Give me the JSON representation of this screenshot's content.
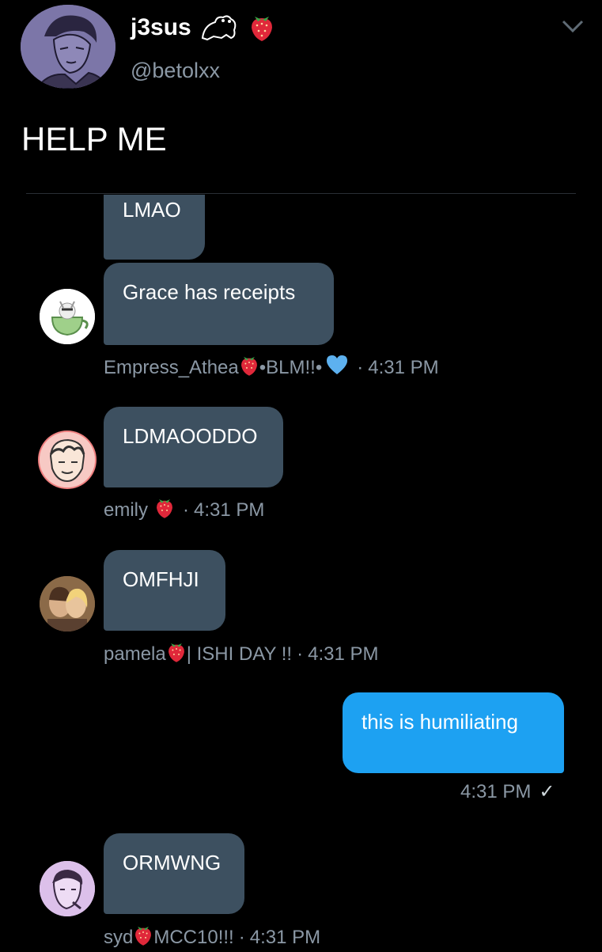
{
  "tweet": {
    "display_name": "j3sus",
    "handle": "@betolxx",
    "text": "HELP ME",
    "name_icons": [
      "frog-icon",
      "strawberry-icon"
    ]
  },
  "messages": [
    {
      "text": "LMAO"
    },
    {
      "text": "Grace has receipts",
      "sender": "Empress_Athea",
      "sender_suffix": "•BLM!!•",
      "time": "4:31 PM"
    },
    {
      "text": "LDMAOODDO",
      "sender": "emily",
      "time": "4:31 PM"
    },
    {
      "text": "OMFHJI",
      "sender": "pamela",
      "sender_suffix": "| ISHI DAY !!",
      "time": "4:31 PM"
    },
    {
      "text": "this is humiliating",
      "time": "4:31 PM",
      "status": "✓",
      "outgoing": true
    },
    {
      "text": "ORMWNG",
      "sender": "syd",
      "sender_suffix": "MCC10!!!",
      "time": "4:31 PM"
    }
  ],
  "separator": "·",
  "colors": {
    "background": "#000000",
    "incoming_bubble": "#3d5060",
    "outgoing_bubble": "#1da1f2",
    "meta_text": "#8b98a5"
  }
}
